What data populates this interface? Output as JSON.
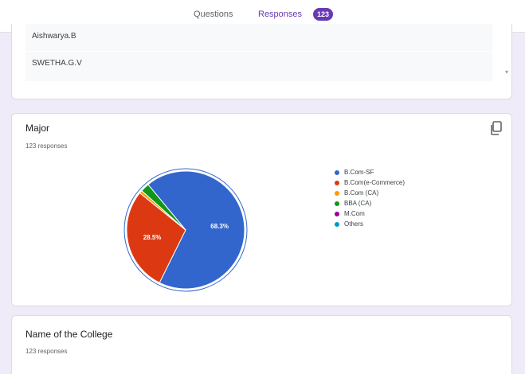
{
  "tabs": {
    "questions_label": "Questions",
    "responses_label": "Responses",
    "responses_count": "123"
  },
  "response_list": {
    "items": [
      "Aishwarya.B",
      "SWETHA.G.V"
    ]
  },
  "major_question": {
    "title": "Major",
    "subtitle": "123 responses",
    "icon": "copy-icon"
  },
  "chart_data": {
    "type": "pie",
    "slices": [
      {
        "label": "B.Com-SF",
        "value": 68.3,
        "color": "#3366cc",
        "data_label": "68.3%"
      },
      {
        "label": "B.Com(e-Commerce)",
        "value": 28.5,
        "color": "#dc3912",
        "data_label": "28.5%"
      },
      {
        "label": "B.Com (CA)",
        "value": 0.8,
        "color": "#ff9900",
        "data_label": ""
      },
      {
        "label": "BBA (CA)",
        "value": 2.4,
        "color": "#109618",
        "data_label": ""
      },
      {
        "label": "M.Com",
        "value": 0,
        "color": "#990099",
        "data_label": ""
      },
      {
        "label": "Others",
        "value": 0,
        "color": "#0099c6",
        "data_label": ""
      }
    ],
    "legend_position": "right"
  },
  "next_question": {
    "title": "Name of the College",
    "subtitle": "123 responses"
  }
}
